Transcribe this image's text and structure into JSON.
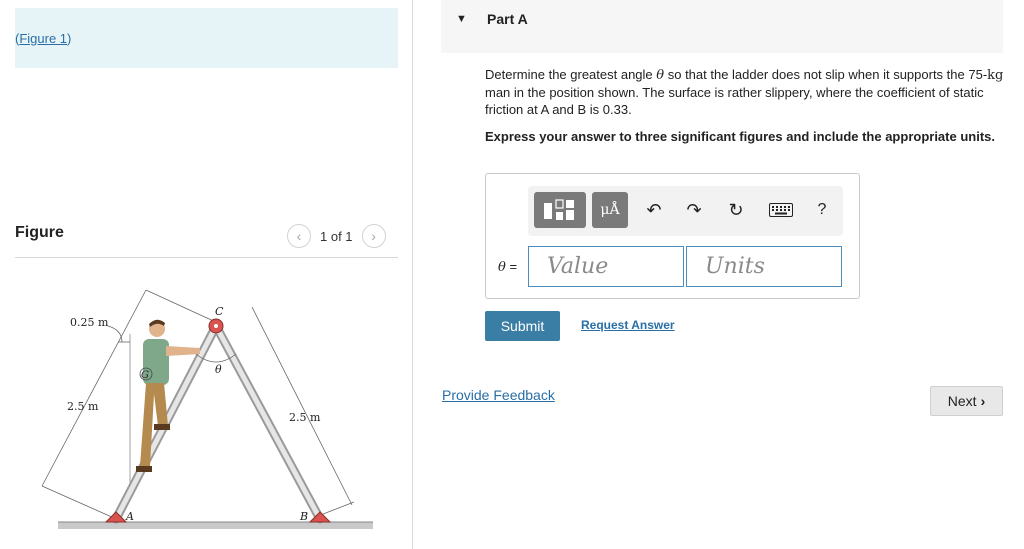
{
  "left_pane": {
    "figure_link": {
      "open_paren": "(",
      "link_text": "Figure 1",
      "close_paren": ")"
    },
    "figure_heading": "Figure",
    "pager": {
      "prev_icon": "chevron-left-icon",
      "text": "1 of 1",
      "next_icon": "chevron-right-icon"
    },
    "figure_labels": {
      "dim_top": "0.25 m",
      "dim_left": "2.5 m",
      "dim_right": "2.5 m",
      "apex": "C",
      "theta": "θ",
      "center_mass": "G",
      "base_left": "A",
      "base_right": "B"
    }
  },
  "part": {
    "caret_icon": "caret-down-icon",
    "title": "Part A"
  },
  "problem": {
    "text_before_theta": "Determine the greatest angle ",
    "theta": "θ",
    "text_mid": " so that the ladder does not slip when it supports the 75-",
    "unit": "kg",
    "text_after": " man in the position shown. The surface is rather slippery, where the coefficient of static friction at A and B is 0.33."
  },
  "instruction": "Express your answer to three significant figures and include the appropriate units.",
  "toolbar": {
    "template_icon": "fraction-template-icon",
    "units_label": "μÅ",
    "undo_icon": "undo-icon",
    "redo_icon": "redo-icon",
    "reset_icon": "reset-icon",
    "keyboard_icon": "keyboard-icon",
    "help_label": "?"
  },
  "answer": {
    "variable": "θ",
    "equals": " =",
    "value_placeholder": "Value",
    "units_placeholder": "Units"
  },
  "actions": {
    "submit_label": "Submit",
    "request_label": "Request Answer",
    "feedback_label": "Provide Feedback",
    "next_label": "Next",
    "next_icon": "chevron-right-icon"
  },
  "colors": {
    "link": "#2a6ea6",
    "submit_bg": "#3a7ea6",
    "figure_link_bg": "#e6f4f7",
    "ladder_pin": "#d9534f"
  }
}
